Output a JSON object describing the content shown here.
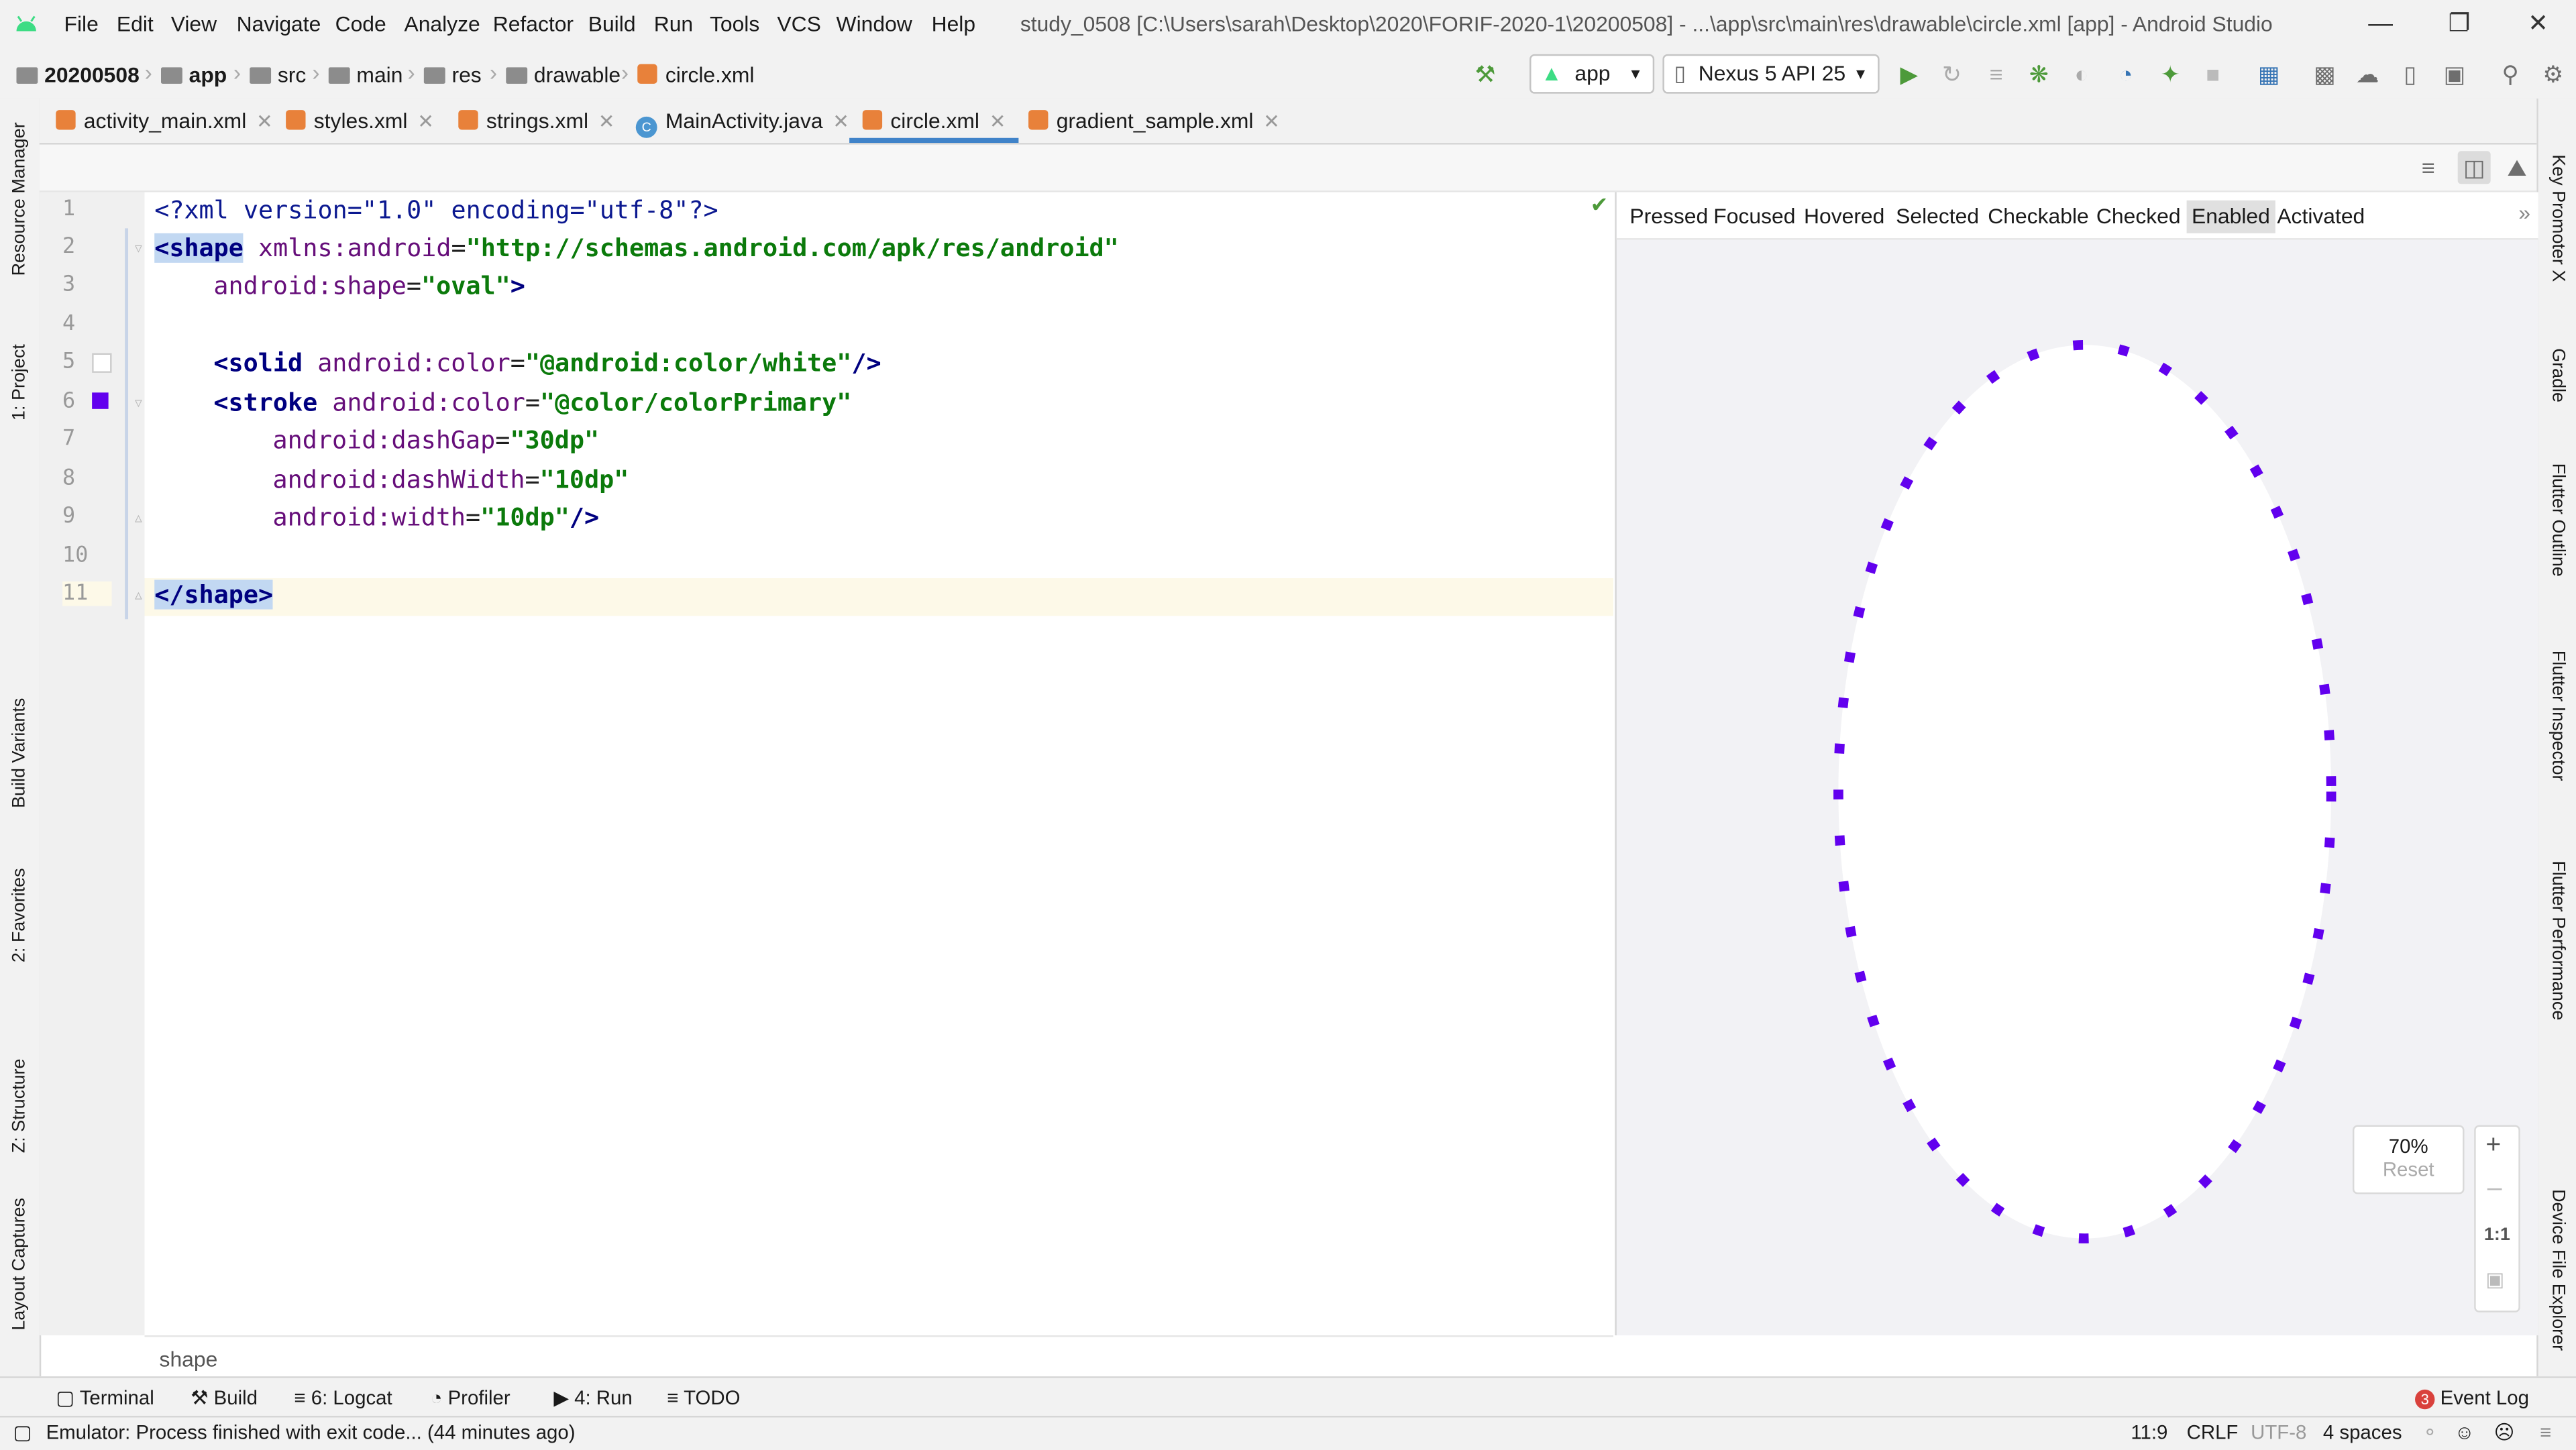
{
  "window": {
    "title": "study_0508 [C:\\Users\\sarah\\Desktop\\2020\\FORIF-2020-1\\20200508] - ...\\app\\src\\main\\res\\drawable\\circle.xml [app] - Android Studio",
    "menu": [
      "File",
      "Edit",
      "View",
      "Navigate",
      "Code",
      "Analyze",
      "Refactor",
      "Build",
      "Run",
      "Tools",
      "VCS",
      "Window",
      "Help"
    ]
  },
  "navbar": {
    "crumbs": [
      "20200508",
      "app",
      "src",
      "main",
      "res",
      "drawable",
      "circle.xml"
    ],
    "run_config": "app",
    "device": "Nexus 5 API 25"
  },
  "tabs": [
    {
      "label": "activity_main.xml",
      "type": "xml"
    },
    {
      "label": "styles.xml",
      "type": "xml"
    },
    {
      "label": "strings.xml",
      "type": "xml"
    },
    {
      "label": "MainActivity.java",
      "type": "java"
    },
    {
      "label": "circle.xml",
      "type": "xml",
      "active": true
    },
    {
      "label": "gradient_sample.xml",
      "type": "xml"
    }
  ],
  "left_tool_windows": [
    "Resource Manager",
    "1: Project",
    "Build Variants",
    "2: Favorites",
    "Z: Structure",
    "Layout Captures"
  ],
  "right_tool_windows": [
    "Key Promoter X",
    "Gradle",
    "Flutter Outline",
    "Flutter Inspector",
    "Flutter Performance",
    "Device File Explorer"
  ],
  "editor": {
    "line_numbers": [
      "1",
      "2",
      "3",
      "4",
      "5",
      "6",
      "7",
      "8",
      "9",
      "10",
      "11"
    ],
    "current_line": "11",
    "breadcrumb": "shape"
  },
  "preview": {
    "states": [
      "Pressed",
      "Focused",
      "Hovered",
      "Selected",
      "Checkable",
      "Checked",
      "Enabled",
      "Activated"
    ],
    "active_state": "Enabled",
    "zoom": "70%",
    "reset_label": "Reset",
    "one_to_one": "1:1",
    "stroke_color": "#6200ee"
  },
  "tool_buttons": [
    {
      "key": "terminal",
      "label": "Terminal"
    },
    {
      "key": "build",
      "label": "Build"
    },
    {
      "key": "logcat",
      "label": "6: Logcat"
    },
    {
      "key": "profiler",
      "label": "Profiler"
    },
    {
      "key": "run",
      "label": "4: Run"
    },
    {
      "key": "todo",
      "label": "TODO"
    }
  ],
  "event_log": {
    "label": "Event Log",
    "count": "3"
  },
  "status": {
    "message": "Emulator: Process finished with exit code... (44 minutes ago)",
    "position": "11:9",
    "line_ending": "CRLF",
    "encoding": "UTF-8",
    "indent": "4 spaces"
  },
  "code": {
    "l1_decl": "<?xml version=\"1.0\" encoding=\"utf-8\"?>",
    "l2_open": "<shape",
    "l2_attr": "xmlns:android",
    "l2_val": "\"http://schemas.android.com/apk/res/android\"",
    "l3_attr": "android:shape",
    "l3_val": "\"oval\"",
    "l5_tag": "<solid",
    "l5_attr": "android:color",
    "l5_val": "\"@android:color/white\"",
    "l5_end": "/>",
    "l6_tag": "<stroke",
    "l6_attr": "android:color",
    "l6_val": "\"@color/colorPrimary\"",
    "l7_attr": "android:dashGap",
    "l7_val": "\"30dp\"",
    "l8_attr": "android:dashWidth",
    "l8_val": "\"10dp\"",
    "l9_attr": "android:width",
    "l9_val": "\"10dp\"",
    "l9_end": "/>",
    "l11_close": "</shape>"
  }
}
